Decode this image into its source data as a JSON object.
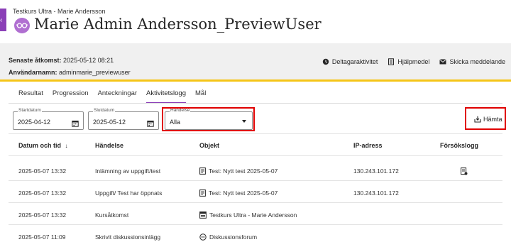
{
  "header": {
    "course_name": "Testkurs Ultra - Marie Andersson",
    "title": "Marie Admin Andersson_PreviewUser",
    "back_icon": "chevron-left-icon"
  },
  "info": {
    "last_access_label": "Senaste åtkomst:",
    "last_access_value": "2025-05-12 08:21",
    "username_label": "Användarnamn:",
    "username_value": "adminmarie_previewuser",
    "actions": {
      "participant_activity": "Deltagaraktivitet",
      "aids": "Hjälpmedel",
      "send_message": "Skicka meddelande"
    }
  },
  "tabs": [
    {
      "label": "Resultat",
      "active": false
    },
    {
      "label": "Progression",
      "active": false
    },
    {
      "label": "Anteckningar",
      "active": false
    },
    {
      "label": "Aktivitetslogg",
      "active": true
    },
    {
      "label": "Mål",
      "active": false
    }
  ],
  "filters": {
    "start_label": "Startdatum",
    "start_value": "2025-04-12",
    "end_label": "Slutdatum",
    "end_value": "2025-05-12",
    "event_label": "Händelse",
    "event_value": "Alla"
  },
  "download_label": "Hämta",
  "table": {
    "headers": {
      "datetime": "Datum och tid",
      "sort_indicator": "↓",
      "event": "Händelse",
      "object": "Objekt",
      "ip": "IP-adress",
      "attempt_log": "Försökslogg"
    },
    "rows": [
      {
        "datetime": "2025-05-07 13:32",
        "event": "Inlämning av uppgift/test",
        "object": "Test: Nytt test 2025-05-07",
        "object_icon": "test-icon",
        "ip": "130.243.101.172",
        "has_attempt_log": true
      },
      {
        "datetime": "2025-05-07 13:32",
        "event": "Uppgift/ Test har öppnats",
        "object": "Test: Nytt test 2025-05-07",
        "object_icon": "test-icon",
        "ip": "130.243.101.172",
        "has_attempt_log": false
      },
      {
        "datetime": "2025-05-07 13:32",
        "event": "Kursåtkomst",
        "object": "Testkurs Ultra - Marie Andersson",
        "object_icon": "course-icon",
        "ip": "",
        "has_attempt_log": false
      },
      {
        "datetime": "2025-05-07 11:09",
        "event": "Skrivit diskussionsinlägg",
        "object": "Diskussionsforum",
        "object_icon": "discussion-icon",
        "ip": "",
        "has_attempt_log": false
      }
    ]
  },
  "colors": {
    "accent": "#8b3fb7",
    "highlight_box": "#e00000",
    "info_bar_border": "#f5c518"
  }
}
